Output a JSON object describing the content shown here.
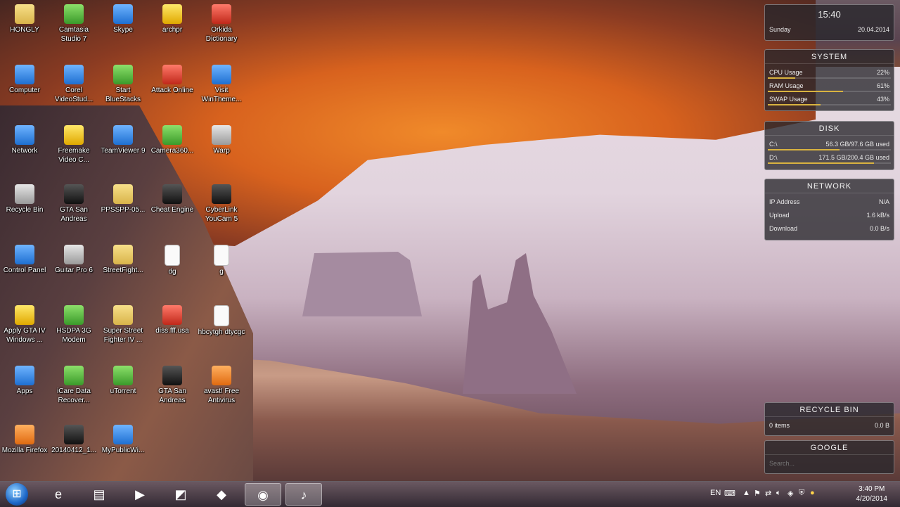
{
  "desktop_icons": [
    {
      "label": "HONGLY",
      "icon": "folder-user-icon",
      "color": "folder"
    },
    {
      "label": "Camtasia Studio 7",
      "icon": "camtasia-icon",
      "color": "green"
    },
    {
      "label": "Skype",
      "icon": "skype-icon",
      "color": "blue"
    },
    {
      "label": "archpr",
      "icon": "archpr-icon",
      "color": "yellow"
    },
    {
      "label": "Orkida Dictionary",
      "icon": "dictionary-icon",
      "color": "red"
    },
    {
      "label": "Computer",
      "icon": "computer-icon",
      "color": "blue"
    },
    {
      "label": "Corel VideoStud...",
      "icon": "corel-icon",
      "color": "blue"
    },
    {
      "label": "Start BlueStacks",
      "icon": "bluestacks-icon",
      "color": "green"
    },
    {
      "label": "Attack Online",
      "icon": "game-icon",
      "color": "red"
    },
    {
      "label": "Visit WinTheme...",
      "icon": "wintheme-icon",
      "color": "blue"
    },
    {
      "label": "Network",
      "icon": "network-icon",
      "color": "blue"
    },
    {
      "label": "Freemake Video C...",
      "icon": "freemake-icon",
      "color": "yellow"
    },
    {
      "label": "TeamViewer 9",
      "icon": "teamviewer-icon",
      "color": "blue"
    },
    {
      "label": "Camera360...",
      "icon": "camera-icon",
      "color": "green"
    },
    {
      "label": "Warp",
      "icon": "warp-icon",
      "color": "gray"
    },
    {
      "label": "Recycle Bin",
      "icon": "recycle-bin-icon",
      "color": "gray"
    },
    {
      "label": "GTA San Andreas",
      "icon": "gta-icon",
      "color": "dark"
    },
    {
      "label": "PPSSPP-05...",
      "icon": "folder-icon",
      "color": "folder"
    },
    {
      "label": "Cheat Engine",
      "icon": "cheat-engine-icon",
      "color": "dark"
    },
    {
      "label": "CyberLink YouCam 5",
      "icon": "youcam-icon",
      "color": "dark"
    },
    {
      "label": "Control Panel",
      "icon": "control-panel-icon",
      "color": "blue"
    },
    {
      "label": "Guitar Pro 6",
      "icon": "guitar-pro-icon",
      "color": "gray"
    },
    {
      "label": "StreetFight...",
      "icon": "folder-icon",
      "color": "folder"
    },
    {
      "label": "dg",
      "icon": "document-icon",
      "color": "page"
    },
    {
      "label": "g",
      "icon": "document-icon",
      "color": "page"
    },
    {
      "label": "Apply GTA IV Windows ...",
      "icon": "star-icon",
      "color": "yellow"
    },
    {
      "label": "HSDPA 3G Modem",
      "icon": "modem-icon",
      "color": "green"
    },
    {
      "label": "Super Street Fighter IV ...",
      "icon": "folder-icon",
      "color": "folder"
    },
    {
      "label": "diss.fff.usa",
      "icon": "image-icon",
      "color": "red"
    },
    {
      "label": "hbcytgh dtycgc",
      "icon": "document-icon",
      "color": "page"
    },
    {
      "label": "Apps",
      "icon": "apps-icon",
      "color": "blue"
    },
    {
      "label": "iCare Data Recover...",
      "icon": "recovery-icon",
      "color": "green"
    },
    {
      "label": "uTorrent",
      "icon": "utorrent-icon",
      "color": "green"
    },
    {
      "label": "GTA San Andreas",
      "icon": "gta-icon",
      "color": "dark"
    },
    {
      "label": "avast! Free Antivirus",
      "icon": "avast-icon",
      "color": "orange"
    },
    {
      "label": "Mozilla Firefox",
      "icon": "firefox-icon",
      "color": "orange"
    },
    {
      "label": "20140412_1...",
      "icon": "video-file-icon",
      "color": "dark"
    },
    {
      "label": "MyPublicWi...",
      "icon": "wifi-icon",
      "color": "blue"
    }
  ],
  "gadgets": {
    "clock": {
      "time": "15:40",
      "day": "Sunday",
      "date": "20.04.2014"
    },
    "system": {
      "title": "SYSTEM",
      "rows": [
        {
          "label": "CPU Usage",
          "value": "22%",
          "level": 0.22
        },
        {
          "label": "RAM Usage",
          "value": "61%",
          "level": 0.61
        },
        {
          "label": "SWAP Usage",
          "value": "43%",
          "level": 0.43
        }
      ]
    },
    "disk": {
      "title": "DISK",
      "rows": [
        {
          "label": "C:\\",
          "value": "56.3 GB/97.6 GB used",
          "level": 0.58
        },
        {
          "label": "D:\\",
          "value": "171.5 GB/200.4 GB used",
          "level": 0.86
        }
      ]
    },
    "network": {
      "title": "NETWORK",
      "rows": [
        {
          "label": "IP Address",
          "value": "N/A"
        },
        {
          "label": "Upload",
          "value": "1.6 kB/s"
        },
        {
          "label": "Download",
          "value": "0.0 B/s"
        }
      ]
    },
    "recycle": {
      "title": "RECYCLE BIN",
      "items": "0 items",
      "size": "0.0 B"
    },
    "google": {
      "title": "GOOGLE",
      "placeholder": "Search..."
    }
  },
  "taskbar": {
    "pinned": [
      {
        "name": "internet-explorer",
        "glyph": "e"
      },
      {
        "name": "file-explorer",
        "glyph": "▤"
      },
      {
        "name": "media-player",
        "glyph": "▶"
      },
      {
        "name": "camtasia",
        "glyph": "◩"
      },
      {
        "name": "orkida-dictionary",
        "glyph": "◆"
      },
      {
        "name": "firefox",
        "glyph": "◉"
      },
      {
        "name": "guitar-pro",
        "glyph": "♪"
      }
    ],
    "language": "EN",
    "time": "3:40 PM",
    "date": "4/20/2014"
  }
}
